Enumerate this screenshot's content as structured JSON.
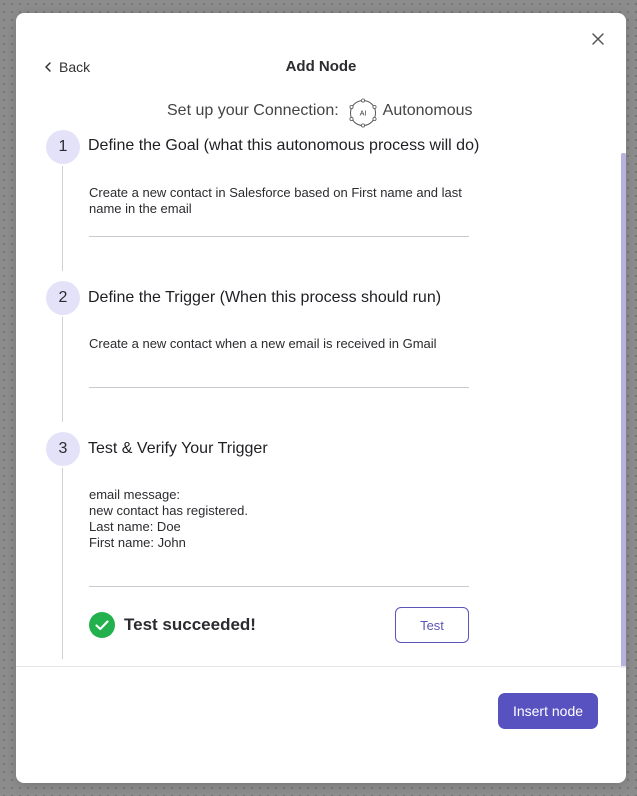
{
  "header": {
    "back_label": "Back",
    "title": "Add Node"
  },
  "connection": {
    "prefix": "Set up your Connection:",
    "badge_text": "AI",
    "name": "Autonomous"
  },
  "steps": [
    {
      "number": "1",
      "title": "Define the Goal (what this autonomous process will do)",
      "value": "Create a new contact in Salesforce based on First name and last name in the email"
    },
    {
      "number": "2",
      "title": "Define the Trigger (When this process should run)",
      "value": "Create a new contact when a new email is received in Gmail"
    },
    {
      "number": "3",
      "title": "Test & Verify Your Trigger",
      "value": "email message:\nnew contact has registered.\nLast name: Doe\nFirst name: John"
    }
  ],
  "test": {
    "status_text": "Test succeeded!",
    "button_label": "Test"
  },
  "footer": {
    "insert_label": "Insert node"
  },
  "colors": {
    "accent": "#5852c1",
    "step_circle": "#e4e2f8",
    "success": "#22b14c"
  },
  "icons": {
    "close": "close-icon",
    "back": "chevron-left-icon",
    "ai": "ai-badge-icon",
    "success": "check-circle-icon"
  }
}
